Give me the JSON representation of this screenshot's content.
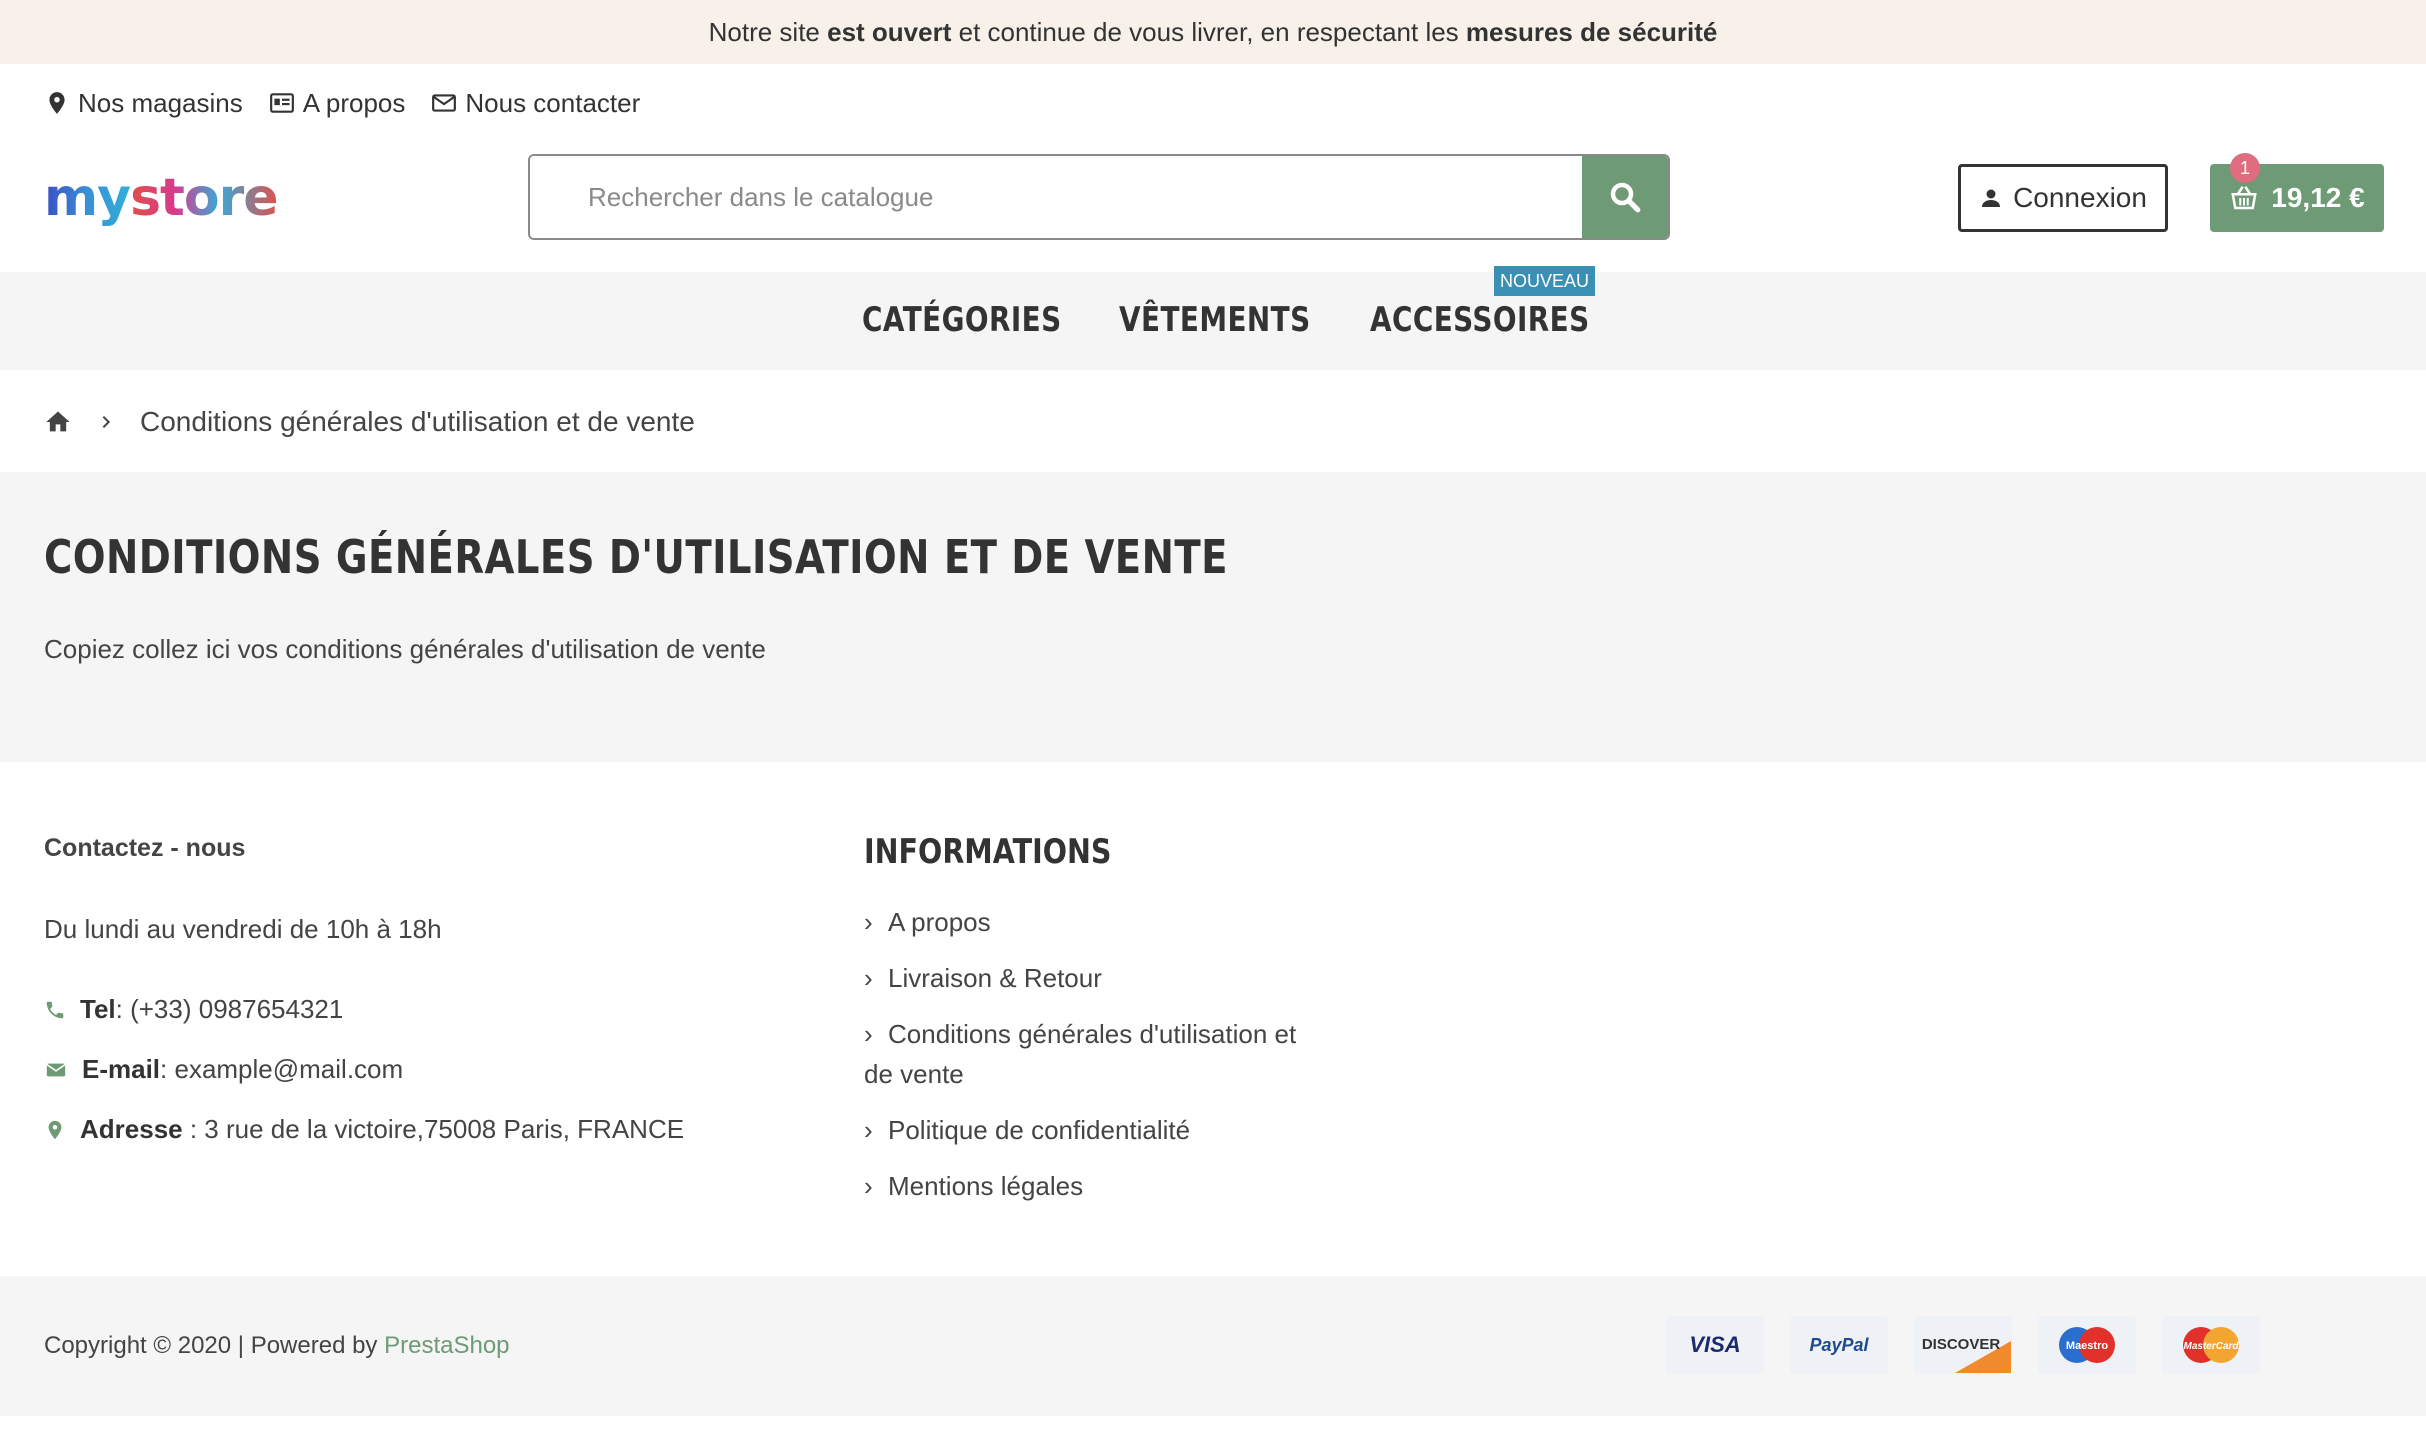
{
  "banner": {
    "part1": "Notre site ",
    "bold1": "est ouvert",
    "part2": " et continue de vous livrer, en respectant les ",
    "bold2": "mesures de sécurité"
  },
  "top_links": {
    "stores": "Nos magasins",
    "about": "A propos",
    "contact": "Nous contacter"
  },
  "logo": {
    "text_my": "my",
    "text_store": "store"
  },
  "search": {
    "placeholder": "Rechercher dans le catalogue"
  },
  "header": {
    "login_label": "Connexion",
    "cart_total": "19,12 €",
    "cart_count": "1"
  },
  "nav": {
    "items": [
      "CATÉGORIES",
      "VÊTEMENTS",
      "ACCESSOIRES"
    ],
    "new_badge": "NOUVEAU"
  },
  "breadcrumb": {
    "current": "Conditions générales d'utilisation et de vente"
  },
  "page": {
    "title": "CONDITIONS GÉNÉRALES D'UTILISATION ET DE VENTE",
    "body": "Copiez collez ici vos conditions générales d'utilisation de vente"
  },
  "footer_contact": {
    "title": "Contactez - nous",
    "hours": "Du lundi au vendredi de 10h à 18h",
    "tel_label": "Tel",
    "tel_value": ": (+33) 0987654321",
    "email_label": "E-mail",
    "email_value": ": example@mail.com",
    "address_label": "Adresse",
    "address_value": " : 3 rue de la victoire,75008 Paris, FRANCE"
  },
  "footer_info": {
    "title": "INFORMATIONS",
    "links": [
      "A propos",
      "Livraison & Retour",
      "Conditions générales d'utilisation et de vente",
      "Politique de confidentialité",
      "Mentions légales"
    ]
  },
  "copyright": {
    "text": "Copyright © 2020 |  Powered by ",
    "brand": "PrestaShop"
  },
  "payment_icons": [
    "VISA",
    "PayPal",
    "DISCOVER",
    "Maestro",
    "MasterCard"
  ],
  "colors": {
    "accent": "#6e9a75",
    "banner_bg": "#f7f1ea",
    "badge_blue": "#3a8fb5",
    "cart_badge": "#e06d7f"
  }
}
